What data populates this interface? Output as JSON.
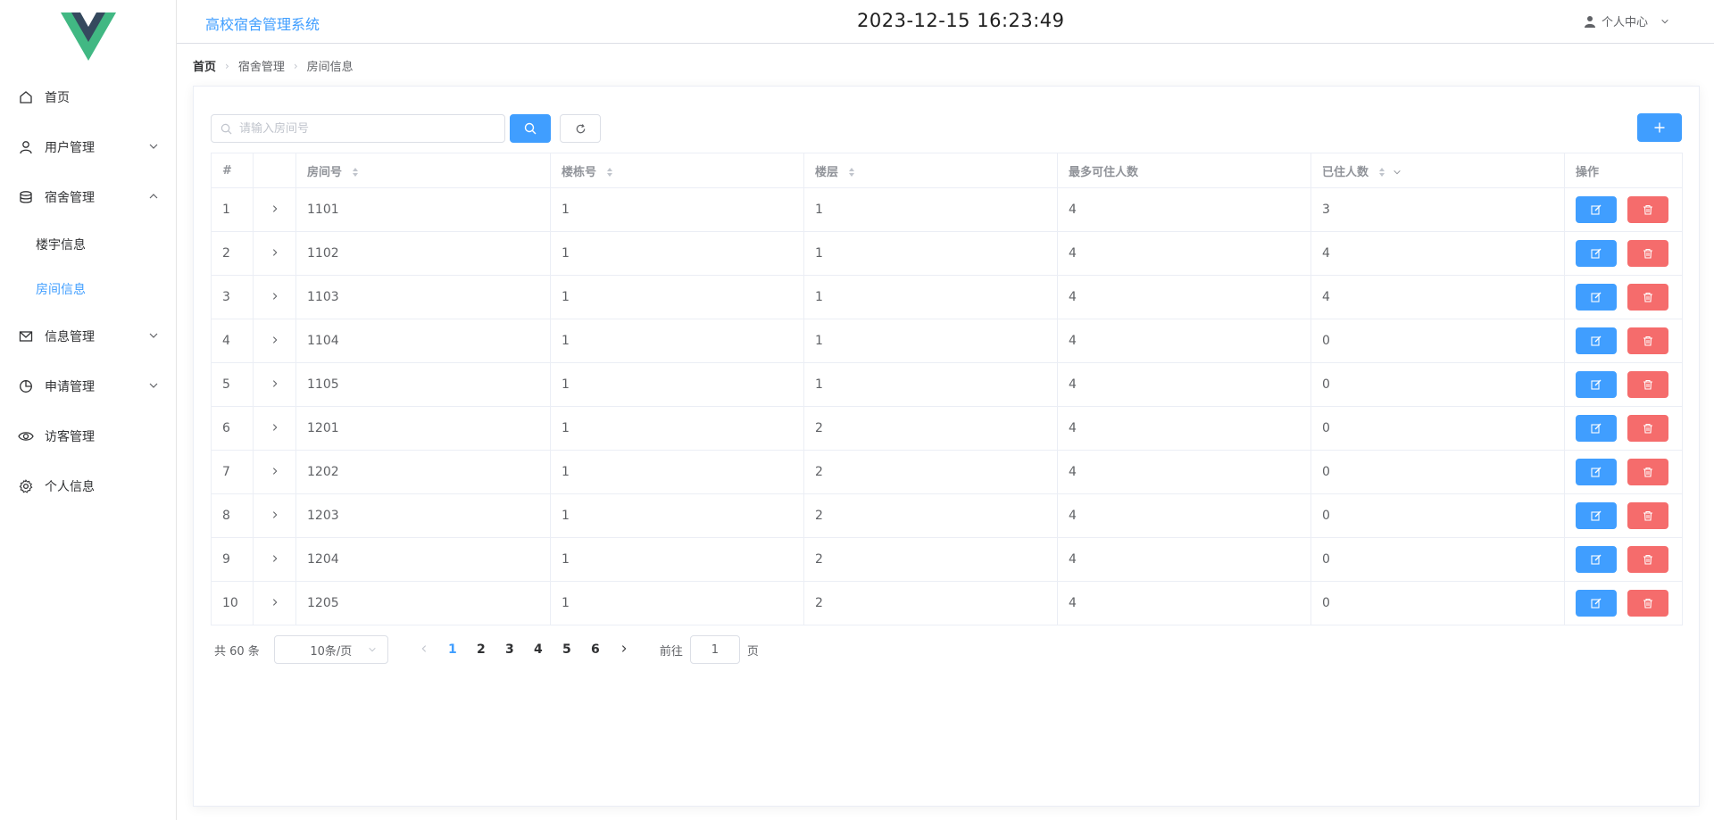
{
  "header": {
    "app_title": "高校宿舍管理系统",
    "clock": "2023-12-15 16:23:49",
    "user_menu_label": "个人中心"
  },
  "sidebar": {
    "items": [
      {
        "label": "首页",
        "icon": "home-icon"
      },
      {
        "label": "用户管理",
        "icon": "user-icon",
        "expandable": true
      },
      {
        "label": "宿舍管理",
        "icon": "database-icon",
        "expanded": true,
        "children": [
          {
            "label": "楼宇信息"
          },
          {
            "label": "房间信息",
            "active": true
          }
        ]
      },
      {
        "label": "信息管理",
        "icon": "message-icon",
        "expandable": true
      },
      {
        "label": "申请管理",
        "icon": "pie-chart-icon",
        "expandable": true
      },
      {
        "label": "访客管理",
        "icon": "view-icon"
      },
      {
        "label": "个人信息",
        "icon": "setting-icon"
      }
    ]
  },
  "breadcrumb": [
    "首页",
    "宿舍管理",
    "房间信息"
  ],
  "toolbar": {
    "search_placeholder": "请输入房间号",
    "search_value": ""
  },
  "table": {
    "columns": [
      "#",
      "",
      "房间号",
      "楼栋号",
      "楼层",
      "最多可住人数",
      "已住人数",
      "操作"
    ],
    "rows": [
      {
        "index": "1",
        "room": "1101",
        "building": "1",
        "floor": "1",
        "max": "4",
        "current": "3"
      },
      {
        "index": "2",
        "room": "1102",
        "building": "1",
        "floor": "1",
        "max": "4",
        "current": "4"
      },
      {
        "index": "3",
        "room": "1103",
        "building": "1",
        "floor": "1",
        "max": "4",
        "current": "4"
      },
      {
        "index": "4",
        "room": "1104",
        "building": "1",
        "floor": "1",
        "max": "4",
        "current": "0"
      },
      {
        "index": "5",
        "room": "1105",
        "building": "1",
        "floor": "1",
        "max": "4",
        "current": "0"
      },
      {
        "index": "6",
        "room": "1201",
        "building": "1",
        "floor": "2",
        "max": "4",
        "current": "0"
      },
      {
        "index": "7",
        "room": "1202",
        "building": "1",
        "floor": "2",
        "max": "4",
        "current": "0"
      },
      {
        "index": "8",
        "room": "1203",
        "building": "1",
        "floor": "2",
        "max": "4",
        "current": "0"
      },
      {
        "index": "9",
        "room": "1204",
        "building": "1",
        "floor": "2",
        "max": "4",
        "current": "0"
      },
      {
        "index": "10",
        "room": "1205",
        "building": "1",
        "floor": "2",
        "max": "4",
        "current": "0"
      }
    ]
  },
  "pagination": {
    "total_text": "共 60 条",
    "page_size": "10条/页",
    "pages": [
      "1",
      "2",
      "3",
      "4",
      "5",
      "6"
    ],
    "current_page": "1",
    "goto_prefix": "前往",
    "goto_value": "1",
    "goto_suffix": "页"
  },
  "colors": {
    "primary": "#409eff",
    "danger": "#f56c6c",
    "logo_green": "#41b883",
    "logo_dark": "#35495e"
  }
}
